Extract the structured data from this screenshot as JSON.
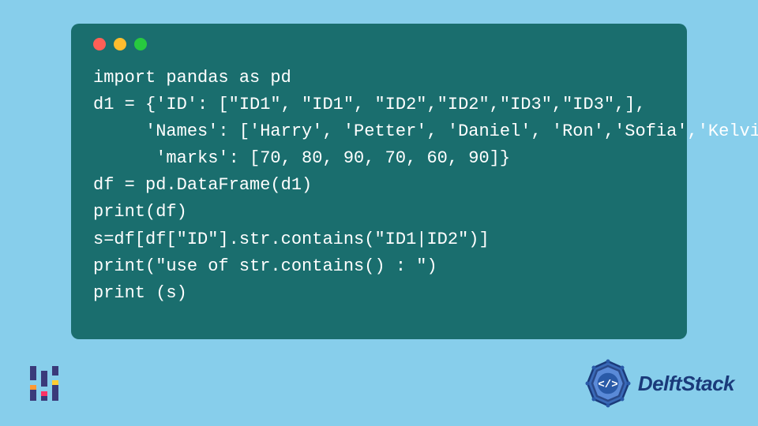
{
  "code": {
    "lines": [
      "import pandas as pd",
      "d1 = {'ID': [\"ID1\", \"ID1\", \"ID2\",\"ID2\",\"ID3\",\"ID3\",],",
      "     'Names': ['Harry', 'Petter', 'Daniel', 'Ron','Sofia','Kelvin'],",
      "      'marks': [70, 80, 90, 70, 60, 90]}",
      "df = pd.DataFrame(d1)",
      "print(df)",
      "s=df[df[\"ID\"].str.contains(\"ID1|ID2\")]",
      "print(\"use of str.contains() : \")",
      "print (s)"
    ]
  },
  "brand": {
    "name": "DelftStack"
  },
  "window": {
    "dots": [
      "red",
      "yellow",
      "green"
    ]
  }
}
